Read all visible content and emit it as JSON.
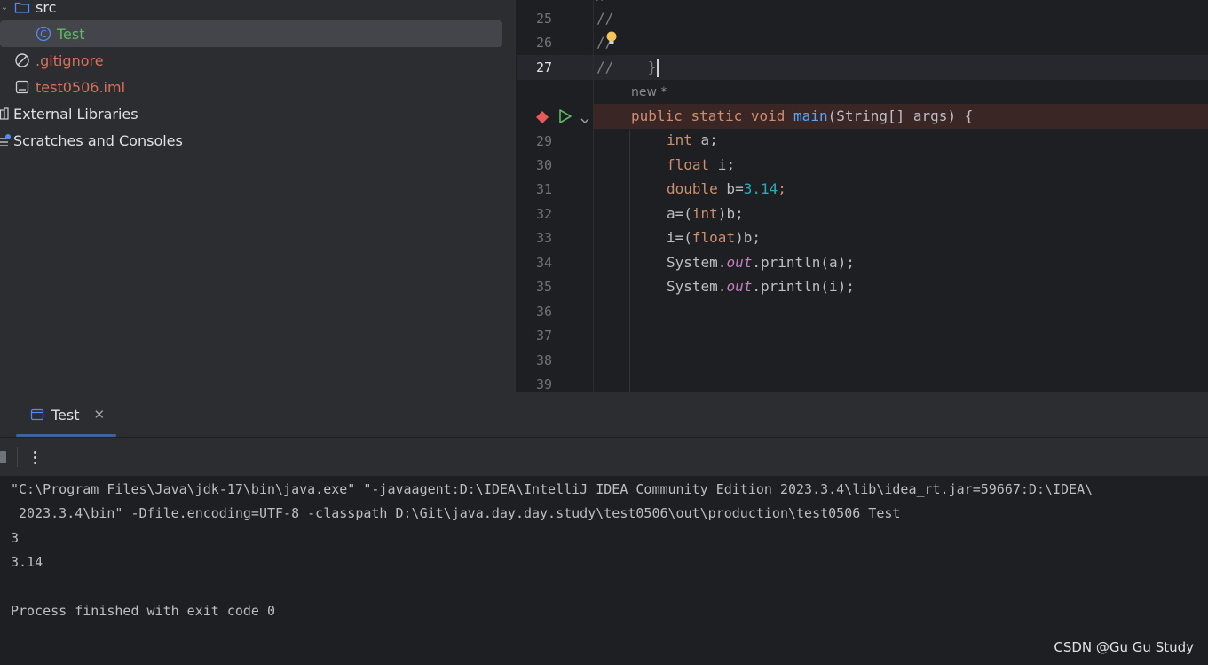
{
  "project_tree": {
    "items": [
      {
        "label": "src",
        "icon": "folder-icon"
      },
      {
        "label": "Test",
        "icon": "class-icon"
      },
      {
        "label": ".gitignore",
        "icon": "ignored-file-icon"
      },
      {
        "label": "test0506.iml",
        "icon": "module-file-icon"
      },
      {
        "label": "External Libraries",
        "icon": "libraries-icon"
      },
      {
        "label": "Scratches and Consoles",
        "icon": "scratches-icon"
      }
    ]
  },
  "editor": {
    "line_numbers": [
      "25",
      "26",
      "27",
      "29",
      "30",
      "31",
      "32",
      "33",
      "34",
      "35",
      "36",
      "37",
      "38",
      "39"
    ],
    "comment_lines": [
      "//",
      "//",
      "//    }"
    ],
    "inlay_hint": "new *",
    "code": {
      "main_kw1": "public",
      "main_kw2": "static",
      "main_kw3": "void",
      "main_fn": "main",
      "main_rest": "(String[] args) {",
      "l29_type": "int",
      "l29_rest": " a;",
      "l30_type": "float",
      "l30_rest": " i;",
      "l31_type": "double",
      "l31_mid": " b=",
      "l31_num": "3.14",
      "l31_end": ";",
      "l32_a": "a=(",
      "l32_kw": "int",
      "l32_b": ")b;",
      "l33_a": "i=(",
      "l33_kw": "float",
      "l33_b": ")b;",
      "l34_a": "System.",
      "l34_fld": "out",
      "l34_b": ".println(a);",
      "l35_a": "System.",
      "l35_fld": "out",
      "l35_b": ".println(i);"
    }
  },
  "run_tool_window": {
    "tab_label": "Test",
    "console_lines": [
      "\"C:\\Program Files\\Java\\jdk-17\\bin\\java.exe\" \"-javaagent:D:\\IDEA\\IntelliJ IDEA Community Edition 2023.3.4\\lib\\idea_rt.jar=59667:D:\\IDEA\\",
      " 2023.3.4\\bin\" -Dfile.encoding=UTF-8 -classpath D:\\Git\\java.day.day.study\\test0506\\out\\production\\test0506 Test",
      "3",
      "3.14",
      "",
      "Process finished with exit code 0"
    ]
  },
  "watermark": "CSDN @Gu Gu Study",
  "colors": {
    "keyword": "#cf8e6d",
    "function": "#56a8f5",
    "number": "#2aacb8",
    "field": "#c77dbb",
    "vcs_ignored": "#d9705b",
    "vcs_new": "#5fb865",
    "breakpoint": "#e55b5b"
  }
}
